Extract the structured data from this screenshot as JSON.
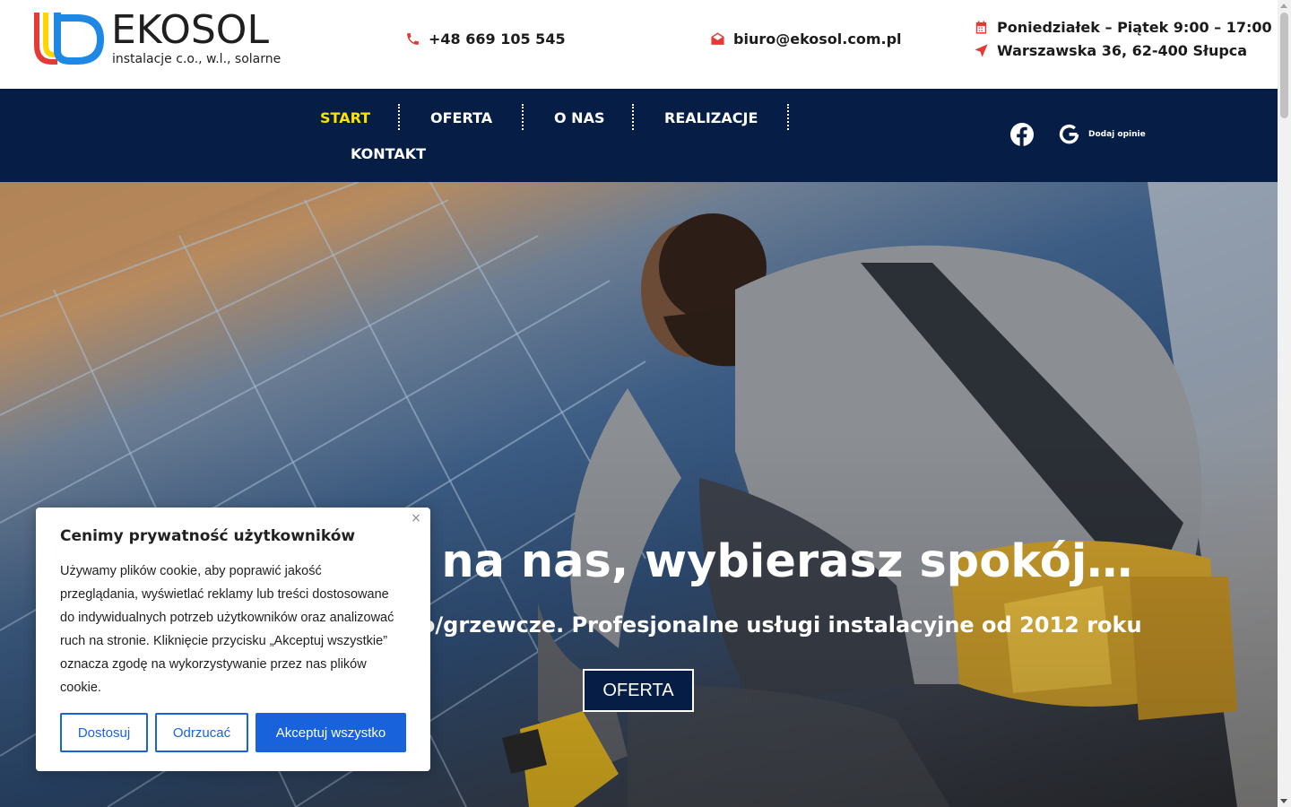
{
  "brand": {
    "name": "EKOSOL",
    "tagline": "instalacje c.o., w.l., solarne"
  },
  "contact": {
    "phone": "+48 669 105 545",
    "email": "biuro@ekosol.com.pl",
    "hours": "Poniedziałek – Piątek 9:00 – 17:00",
    "address": "Warszawska 36, 62-400 Słupca",
    "icon_color": "#e53935"
  },
  "nav": {
    "items": [
      {
        "label": "START",
        "active": true
      },
      {
        "label": "OFERTA",
        "active": false
      },
      {
        "label": "O NAS",
        "active": false
      },
      {
        "label": "REALIZACJE",
        "active": false
      },
      {
        "label": "KONTAKT",
        "active": false
      }
    ],
    "review_label": "Dodaj opinie",
    "background": "#061e46",
    "active_color": "#ffe100"
  },
  "hero": {
    "title": "ę na nas, wybierasz spokój…",
    "subtitle": "rno/grzewcze. Profesjonalne usługi instalacyjne od 2012 roku",
    "button_label": "OFERTA"
  },
  "cookie": {
    "title": "Cenimy prywatność użytkowników",
    "text": "Używamy plików cookie, aby poprawić jakość przeglądania, wyświetlać reklamy lub treści dostosowane do indywidualnych potrzeb użytkowników oraz analizować ruch na stronie. Kliknięcie przycisku „Akceptuj wszystkie” oznacza zgodę na wykorzystywanie przez nas plików cookie.",
    "close_symbol": "×",
    "customize_label": "Dostosuj",
    "reject_label": "Odrzucać",
    "accept_label": "Akceptuj wszystko",
    "accent": "#1863dc"
  }
}
